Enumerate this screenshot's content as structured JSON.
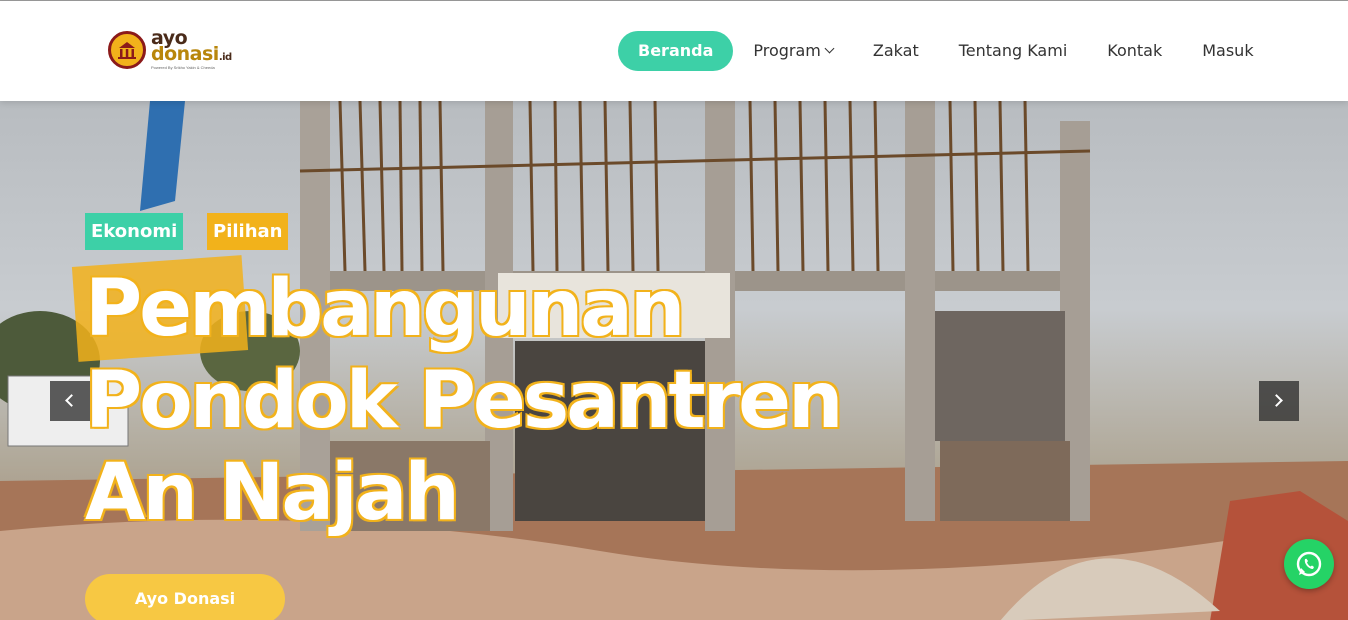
{
  "header": {
    "logo": {
      "line1": "ayo",
      "line2": "donasi",
      "tld": ".id",
      "tagline": "Powered By Srikho Yakin & Cheeda",
      "icon": "mosque-dome-icon"
    },
    "nav": [
      {
        "label": "Beranda",
        "active": true
      },
      {
        "label": "Program",
        "has_dropdown": true
      },
      {
        "label": "Zakat"
      },
      {
        "label": "Tentang Kami"
      },
      {
        "label": "Kontak"
      },
      {
        "label": "Masuk"
      }
    ]
  },
  "hero": {
    "tags": [
      "Ekonomi",
      "Pilihan"
    ],
    "title_lines": [
      "Pembangunan",
      "Pondok Pesantren",
      "An Najah"
    ],
    "cta_label": "Ayo Donasi",
    "prev_icon": "chevron-left-icon",
    "next_icon": "chevron-right-icon"
  },
  "floating": {
    "whatsapp_icon": "whatsapp-icon"
  },
  "colors": {
    "accent_green": "#3dd0a7",
    "accent_yellow": "#f2b21b",
    "cta_yellow": "#f7c843",
    "whatsapp_green": "#25d366"
  }
}
